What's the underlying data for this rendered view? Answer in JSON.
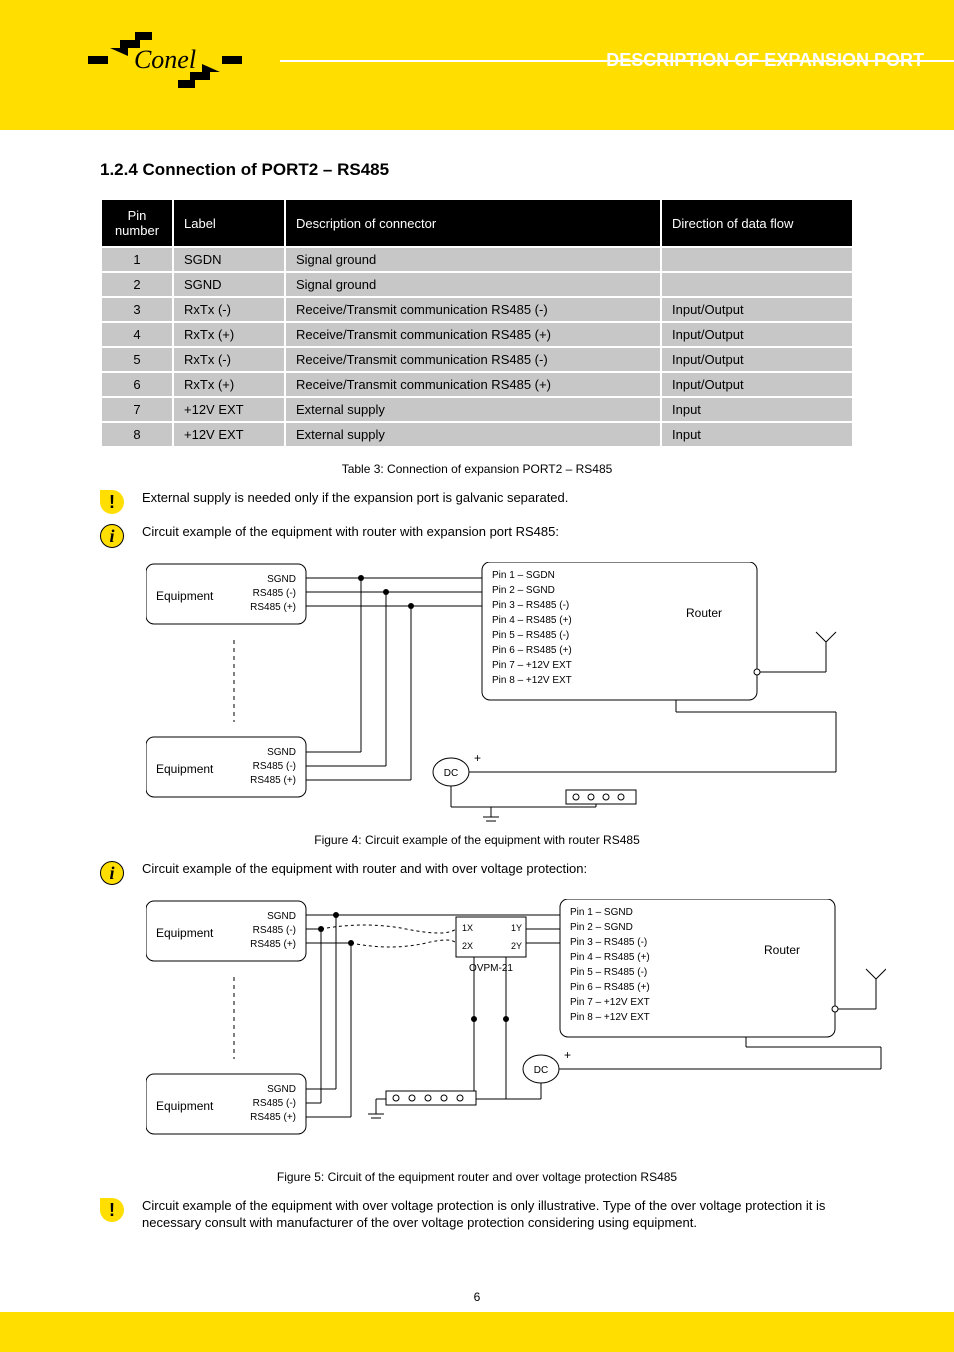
{
  "header": {
    "brand": "Conel",
    "title": "DESCRIPTION OF EXPANSION PORT"
  },
  "section": {
    "heading": "1.2.4 Connection of PORT2 – RS485"
  },
  "table": {
    "headers": [
      "Pin number",
      "Label",
      "Description of connector",
      "Direction of data flow"
    ],
    "rows": [
      [
        "1",
        "SGDN",
        "Signal ground",
        ""
      ],
      [
        "2",
        "SGND",
        "Signal ground",
        ""
      ],
      [
        "3",
        "RxTx (-)",
        "Receive/Transmit communication RS485 (-)",
        "Input/Output"
      ],
      [
        "4",
        "RxTx (+)",
        "Receive/Transmit communication RS485 (+)",
        "Input/Output"
      ],
      [
        "5",
        "RxTx (-)",
        "Receive/Transmit communication RS485 (-)",
        "Input/Output"
      ],
      [
        "6",
        "RxTx (+)",
        "Receive/Transmit communication RS485 (+)",
        "Input/Output"
      ],
      [
        "7",
        "+12V EXT",
        "External supply",
        "Input"
      ],
      [
        "8",
        "+12V EXT",
        "External supply",
        "Input"
      ]
    ],
    "caption": "Table 3: Connection of expansion PORT2 – RS485"
  },
  "notes": {
    "warn1": "External supply is needed only if the expansion port is galvanic separated.",
    "info1": "Circuit example of the equipment with router with expansion port RS485:",
    "info2": "Circuit example of the equipment with router and with over voltage protection:",
    "warn2": "Circuit example of the equipment with over voltage protection is only illustrative. Type of the over voltage protection it is necessary consult with manufacturer of the over voltage protection considering using equipment."
  },
  "figures": {
    "fig4_caption": "Figure 4: Circuit example of the equipment with router RS485",
    "fig5_caption": "Figure 5: Circuit of the equipment router and over voltage protection RS485"
  },
  "diagram_labels": {
    "equipment": "Equipment",
    "router": "Router",
    "dc": "DC",
    "ovpm": "OVPM-21",
    "sgnd": "SGND",
    "rs485neg": "RS485 (-)",
    "rs485pos": "RS485 (+)",
    "pin1": "Pin 1 – SGDN",
    "pin1b": "Pin 1 – SGND",
    "pin2": "Pin 2 – SGND",
    "pin3": "Pin 3 – RS485 (-)",
    "pin4": "Pin 4 – RS485 (+)",
    "pin5": "Pin 5 – RS485 (-)",
    "pin6": "Pin 6 – RS485 (+)",
    "pin7": "Pin 7 – +12V EXT",
    "pin8": "Pin 8 – +12V EXT",
    "x1": "1X",
    "y1": "1Y",
    "x2": "2X",
    "y2": "2Y",
    "plus": "+"
  },
  "page_number": "6"
}
